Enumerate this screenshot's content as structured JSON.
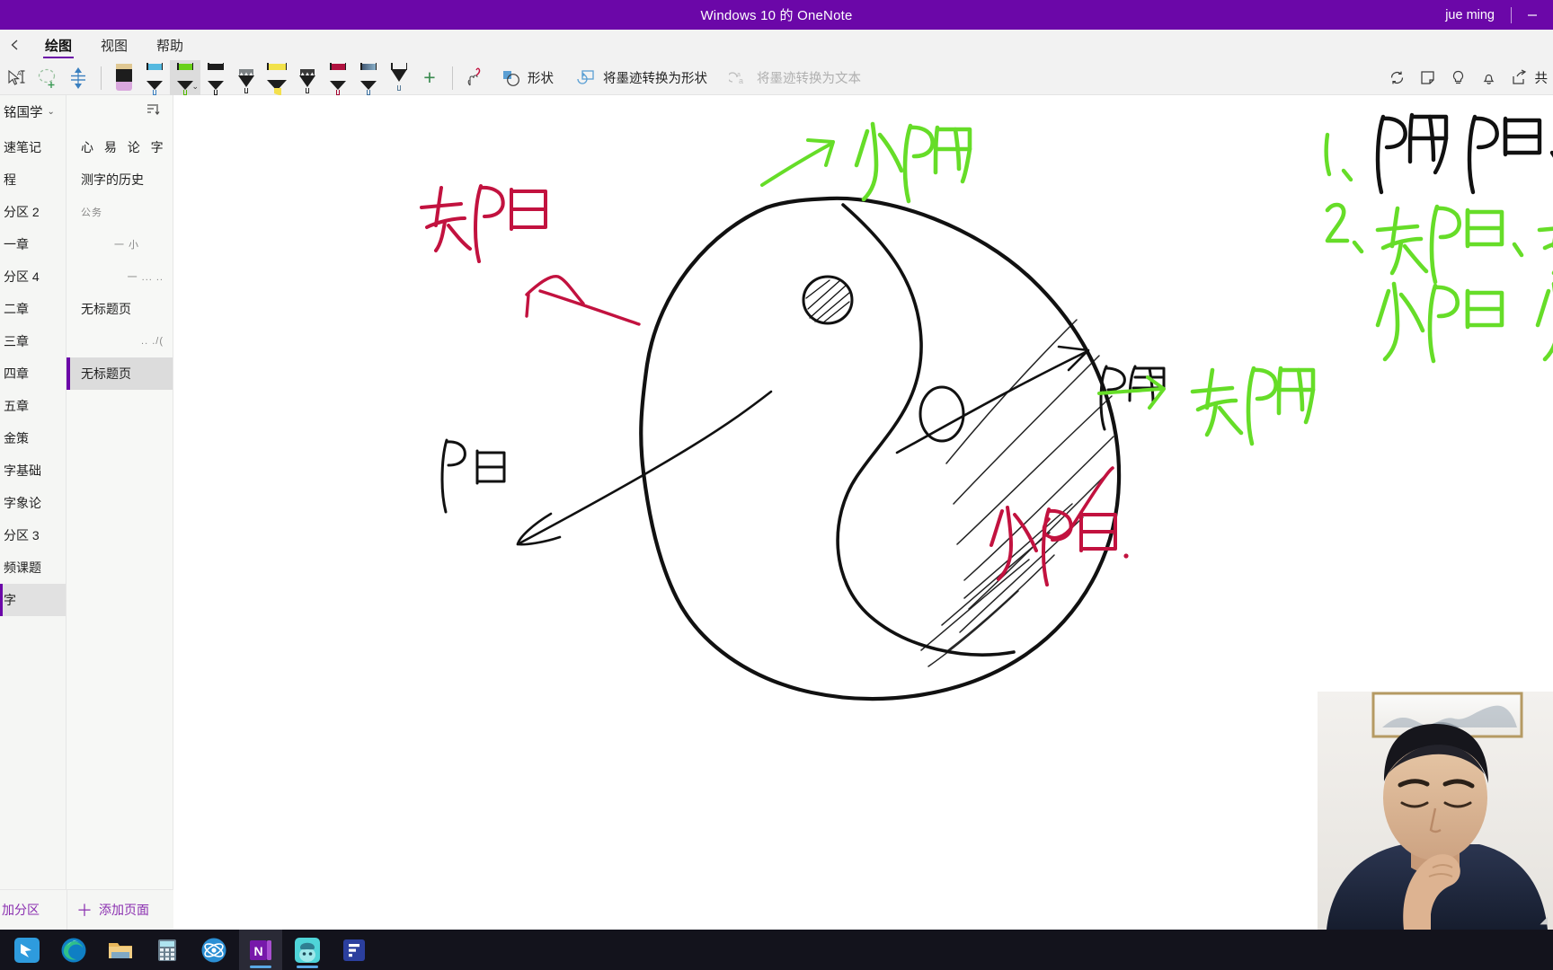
{
  "titlebar": {
    "title": "Windows 10 的 OneNote",
    "user": "jue ming",
    "minimize_label": "—"
  },
  "ribbon": {
    "back_icon": "back-arrow-icon",
    "tabs": [
      {
        "label": "绘图",
        "active": true
      },
      {
        "label": "视图",
        "active": false
      },
      {
        "label": "帮助",
        "active": false
      }
    ],
    "tools": {
      "lasso_label": "套索选择",
      "eraser_label": "橡皮擦",
      "thickness_label": "笔画粗细",
      "add_pen_label": "+",
      "pens": [
        {
          "name": "pen-eraser",
          "cap": "#e0c893",
          "accent": "#d9a7dd",
          "selected": false,
          "type": "eraser"
        },
        {
          "name": "pen-blue",
          "cap": "#55b9e0",
          "accent": "#3a7fbf",
          "selected": false,
          "type": "pen"
        },
        {
          "name": "pen-green",
          "cap": "#69d11a",
          "accent": "#55b800",
          "selected": true,
          "type": "pen"
        },
        {
          "name": "pen-black",
          "cap": "#1d1d1d",
          "accent": "#1d1d1d",
          "selected": false,
          "type": "pen"
        },
        {
          "name": "pencil-grey",
          "cap": "#7d8285",
          "accent": "#55595c",
          "selected": false,
          "type": "pencil"
        },
        {
          "name": "highlighter-yellow",
          "cap": "#f2e24a",
          "accent": "#f4e04d",
          "selected": false,
          "type": "highlighter"
        },
        {
          "name": "pencil-dark",
          "cap": "#3a3a3a",
          "accent": "#2b2b2b",
          "selected": false,
          "type": "pencil"
        },
        {
          "name": "pen-crimson",
          "cap": "#b0123f",
          "accent": "#a3002f",
          "selected": false,
          "type": "pen"
        },
        {
          "name": "pen-steel",
          "cap": "#4a6a8a",
          "accent": "#3a6f9f",
          "selected": false,
          "type": "pen"
        },
        {
          "name": "pen-plain",
          "cap": "#ffffff",
          "accent": "#5a7d9a",
          "selected": false,
          "type": "pen"
        }
      ],
      "ink_to_shape_toggle": "手写转形状",
      "shape_label": "形状",
      "ink_to_shape_label": "将墨迹转换为形状",
      "ink_to_text_label": "将墨迹转换为文本"
    },
    "right_icons": [
      "sync-icon",
      "sticky-note-icon",
      "lightbulb-icon",
      "bell-icon",
      "share-icon"
    ],
    "share_label": "共"
  },
  "sidebar": {
    "notebook_name": "铭国学",
    "sections": [
      {
        "label": "速笔记",
        "active": false
      },
      {
        "label": "程",
        "active": false
      },
      {
        "label": "分区 2",
        "active": false
      },
      {
        "label": "一章",
        "active": false
      },
      {
        "label": "分区 4",
        "active": false
      },
      {
        "label": "二章",
        "active": false
      },
      {
        "label": "三章",
        "active": false
      },
      {
        "label": "四章",
        "active": false
      },
      {
        "label": "五章",
        "active": false
      },
      {
        "label": "金策",
        "active": false
      },
      {
        "label": "字基础",
        "active": false
      },
      {
        "label": "字象论",
        "active": false
      },
      {
        "label": "分区 3",
        "active": false
      },
      {
        "label": "频课题",
        "active": false
      },
      {
        "label": "字",
        "active": true
      }
    ],
    "add_section_label": "加分区",
    "sort_icon": "sort-icon"
  },
  "pages": {
    "items": [
      {
        "label": "心 易 论 字",
        "active": false,
        "ink": false,
        "spaced": true
      },
      {
        "label": "测字的历史",
        "active": false,
        "ink": false,
        "spaced": false
      },
      {
        "label": "公务",
        "active": false,
        "ink": true,
        "align": "left"
      },
      {
        "label": "一 小",
        "active": false,
        "ink": true,
        "align": "center"
      },
      {
        "label": "一 ...  ..",
        "active": false,
        "ink": true,
        "align": "right"
      },
      {
        "label": "无标题页",
        "active": false,
        "ink": false,
        "spaced": false
      },
      {
        "label": ".. ./(",
        "active": false,
        "ink": true,
        "align": "right"
      },
      {
        "label": "无标题页",
        "active": true,
        "ink": false,
        "spaced": false
      }
    ],
    "add_page_label": "添加页面"
  },
  "canvas": {
    "ink_colors": {
      "black": "#111111",
      "red": "#c2123f",
      "green": "#66dd28"
    },
    "annotations": [
      {
        "id": "label-red-top-left",
        "text": "老阳",
        "color": "#c2123f",
        "note": "upper-left red handwriting"
      },
      {
        "id": "label-green-top",
        "text": "少阳",
        "color": "#66dd28",
        "note": "green with arrow, top"
      },
      {
        "id": "label-black-right",
        "text": "阳",
        "color": "#111111",
        "note": "black label at right arrow tip"
      },
      {
        "id": "label-black-bottomleft",
        "text": "阳",
        "color": "#111111",
        "note": "black label lower-left arrow tip"
      },
      {
        "id": "label-green-right",
        "text": "老阴",
        "color": "#66dd28",
        "note": "green with arrow, right side"
      },
      {
        "id": "label-red-bottom",
        "text": "少阴",
        "color": "#c2123f",
        "note": "red with hook, bottom"
      }
    ],
    "notes_list": [
      {
        "index": "1、",
        "index_color": "#66dd28",
        "text": "阴 阳、",
        "text_color": "#111111"
      },
      {
        "index": "2、",
        "index_color": "#66dd28",
        "text": "老阳、老阴",
        "text_color": "#66dd28"
      },
      {
        "index": "",
        "index_color": "#66dd28",
        "text": "少阳  少阴.",
        "text_color": "#66dd28"
      }
    ]
  },
  "taskbar": {
    "items": [
      {
        "name": "taskbar-bird-app",
        "running": false,
        "active": false
      },
      {
        "name": "taskbar-edge",
        "running": false,
        "active": false
      },
      {
        "name": "taskbar-explorer",
        "running": false,
        "active": false
      },
      {
        "name": "taskbar-calculator",
        "running": false,
        "active": false
      },
      {
        "name": "taskbar-atom-app",
        "running": false,
        "active": false
      },
      {
        "name": "taskbar-onenote",
        "running": true,
        "active": true
      },
      {
        "name": "taskbar-anime-app",
        "running": true,
        "active": false
      },
      {
        "name": "taskbar-figma-app",
        "running": false,
        "active": false
      }
    ]
  },
  "webcam": {
    "resize_handle": "◢"
  }
}
